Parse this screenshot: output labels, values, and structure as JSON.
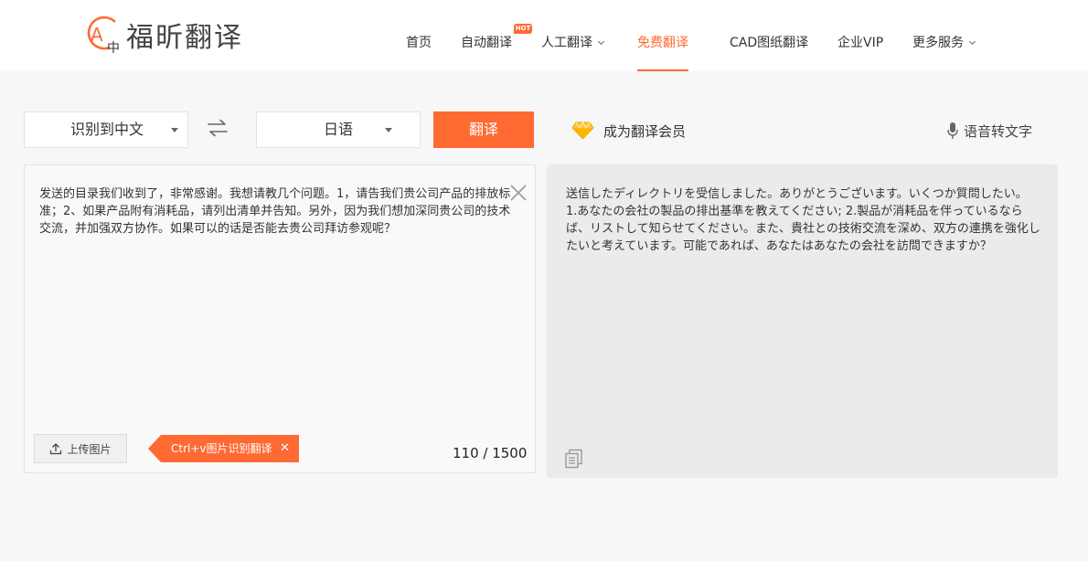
{
  "brand": {
    "name": "福昕翻译",
    "logo_letters": [
      "A",
      "中"
    ],
    "accent_color": "#ff6a33"
  },
  "nav": {
    "items": [
      {
        "label": "首页"
      },
      {
        "label": "自动翻译",
        "badge": "HOT"
      },
      {
        "label": "人工翻译",
        "has_dropdown": true
      },
      {
        "label": "免费翻译",
        "active": true
      },
      {
        "label": "CAD图纸翻译"
      },
      {
        "label": "企业VIP"
      },
      {
        "label": "更多服务",
        "has_dropdown": true
      }
    ]
  },
  "toolbar": {
    "source_language": "识别到中文",
    "target_language": "日语",
    "swap_icon": "swap-arrows-icon",
    "translate_label": "翻译",
    "vip_label": "成为翻译会员",
    "vip_icon": "diamond-icon",
    "voice_label": "语音转文字",
    "voice_icon": "microphone-icon"
  },
  "source": {
    "text": "发送的目录我们收到了，非常感谢。我想请教几个问题。1，请告我们贵公司产品的排放标准；2、如果产品附有消耗品，请列出清单并告知。另外，因为我们想加深同贵公司的技术交流，并加强双方协作。如果可以的话是否能去贵公司拜访参观呢？",
    "upload_label": "上传图片",
    "tip_label": "Ctrl+v图片识别翻译",
    "char_count": "110 / 1500"
  },
  "target": {
    "text": "送信したディレクトリを受信しました。ありがとうございます。いくつか質問したい。 1.あなたの会社の製品の排出基準を教えてください; 2.製品が消耗品を伴っているならば、リストして知らせてください。また、貴社との技術交流を深め、双方の連携を強化したいと考えています。可能であれば、あなたはあなたの会社を訪問できますか？"
  }
}
